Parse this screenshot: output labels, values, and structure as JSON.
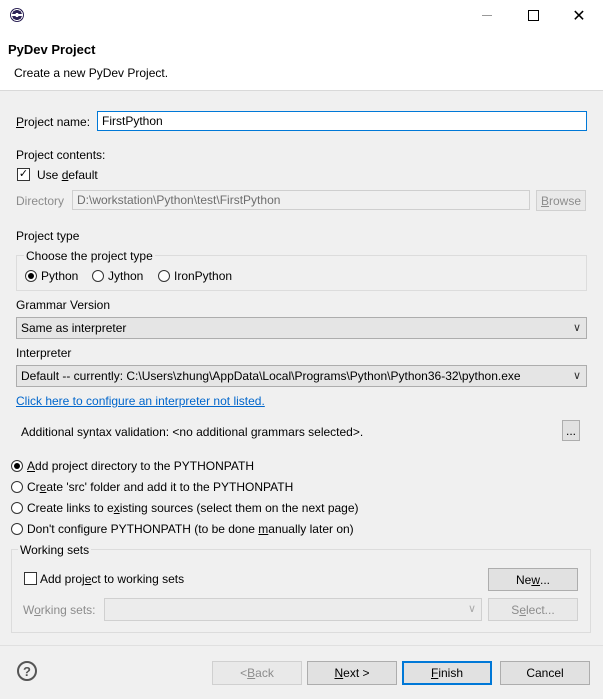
{
  "window": {
    "minimize_icon": "minimize-icon",
    "maximize_icon": "maximize-icon",
    "close_icon": "close-icon",
    "close_glyph": "✕"
  },
  "header": {
    "title": "PyDev Project",
    "description": "Create a new PyDev Project."
  },
  "project_name": {
    "label": "Project name:",
    "value": "FirstPython"
  },
  "project_contents": {
    "label": "Project contents:",
    "use_default_label": "Use default",
    "use_default_checked": true,
    "check_glyph": "✓",
    "directory_label": "Directory",
    "directory_value": "D:\\workstation\\Python\\test\\FirstPython",
    "browse_label": "Browse"
  },
  "project_type": {
    "label": "Project type",
    "group_label": "Choose the project type",
    "options": [
      "Python",
      "Jython",
      "IronPython"
    ],
    "selected": "Python"
  },
  "grammar": {
    "label": "Grammar Version",
    "value": "Same as interpreter"
  },
  "interpreter": {
    "label": "Interpreter",
    "value": "Default  --  currently: C:\\Users\\zhung\\AppData\\Local\\Programs\\Python\\Python36-32\\python.exe",
    "configure_link": "Click here to configure an interpreter not listed."
  },
  "syntax": {
    "text": "Additional syntax validation: <no additional grammars selected>.",
    "button_label": "..."
  },
  "pythonpath": {
    "options": [
      "Add project directory to the PYTHONPATH",
      "Create 'src' folder and add it to the PYTHONPATH",
      "Create links to existing sources (select them on the next page)",
      "Don't configure PYTHONPATH (to be done manually later on)"
    ],
    "selected_index": 0
  },
  "working_sets": {
    "group_label": "Working sets",
    "add_label": "Add project to working sets",
    "add_checked": false,
    "new_label": "New...",
    "sets_label": "Working sets:",
    "select_label": "Select..."
  },
  "footer": {
    "help_glyph": "?",
    "back_label": "< Back",
    "next_label": "Next >",
    "finish_label": "Finish",
    "cancel_label": "Cancel"
  },
  "chevron_glyph": "∨",
  "colors": {
    "accent": "#0078d7",
    "link": "#0066cc",
    "close_red": "#e81123"
  }
}
